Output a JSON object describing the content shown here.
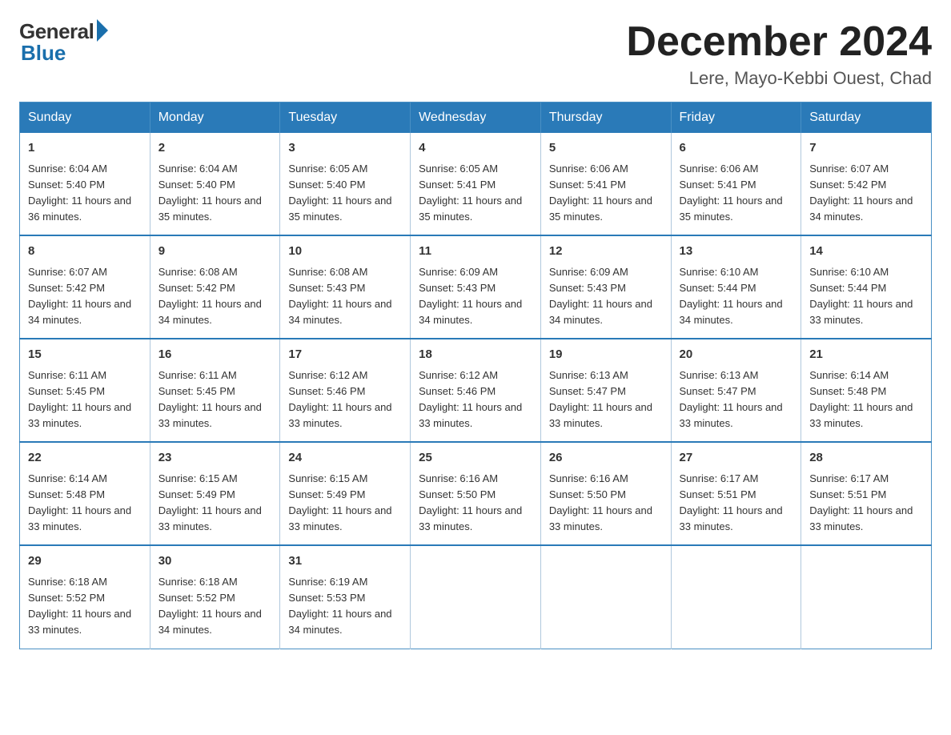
{
  "header": {
    "logo_general": "General",
    "logo_blue": "Blue",
    "month_title": "December 2024",
    "location": "Lere, Mayo-Kebbi Ouest, Chad"
  },
  "days_of_week": [
    "Sunday",
    "Monday",
    "Tuesday",
    "Wednesday",
    "Thursday",
    "Friday",
    "Saturday"
  ],
  "weeks": [
    [
      {
        "day": "1",
        "sunrise": "6:04 AM",
        "sunset": "5:40 PM",
        "daylight": "11 hours and 36 minutes."
      },
      {
        "day": "2",
        "sunrise": "6:04 AM",
        "sunset": "5:40 PM",
        "daylight": "11 hours and 35 minutes."
      },
      {
        "day": "3",
        "sunrise": "6:05 AM",
        "sunset": "5:40 PM",
        "daylight": "11 hours and 35 minutes."
      },
      {
        "day": "4",
        "sunrise": "6:05 AM",
        "sunset": "5:41 PM",
        "daylight": "11 hours and 35 minutes."
      },
      {
        "day": "5",
        "sunrise": "6:06 AM",
        "sunset": "5:41 PM",
        "daylight": "11 hours and 35 minutes."
      },
      {
        "day": "6",
        "sunrise": "6:06 AM",
        "sunset": "5:41 PM",
        "daylight": "11 hours and 35 minutes."
      },
      {
        "day": "7",
        "sunrise": "6:07 AM",
        "sunset": "5:42 PM",
        "daylight": "11 hours and 34 minutes."
      }
    ],
    [
      {
        "day": "8",
        "sunrise": "6:07 AM",
        "sunset": "5:42 PM",
        "daylight": "11 hours and 34 minutes."
      },
      {
        "day": "9",
        "sunrise": "6:08 AM",
        "sunset": "5:42 PM",
        "daylight": "11 hours and 34 minutes."
      },
      {
        "day": "10",
        "sunrise": "6:08 AM",
        "sunset": "5:43 PM",
        "daylight": "11 hours and 34 minutes."
      },
      {
        "day": "11",
        "sunrise": "6:09 AM",
        "sunset": "5:43 PM",
        "daylight": "11 hours and 34 minutes."
      },
      {
        "day": "12",
        "sunrise": "6:09 AM",
        "sunset": "5:43 PM",
        "daylight": "11 hours and 34 minutes."
      },
      {
        "day": "13",
        "sunrise": "6:10 AM",
        "sunset": "5:44 PM",
        "daylight": "11 hours and 34 minutes."
      },
      {
        "day": "14",
        "sunrise": "6:10 AM",
        "sunset": "5:44 PM",
        "daylight": "11 hours and 33 minutes."
      }
    ],
    [
      {
        "day": "15",
        "sunrise": "6:11 AM",
        "sunset": "5:45 PM",
        "daylight": "11 hours and 33 minutes."
      },
      {
        "day": "16",
        "sunrise": "6:11 AM",
        "sunset": "5:45 PM",
        "daylight": "11 hours and 33 minutes."
      },
      {
        "day": "17",
        "sunrise": "6:12 AM",
        "sunset": "5:46 PM",
        "daylight": "11 hours and 33 minutes."
      },
      {
        "day": "18",
        "sunrise": "6:12 AM",
        "sunset": "5:46 PM",
        "daylight": "11 hours and 33 minutes."
      },
      {
        "day": "19",
        "sunrise": "6:13 AM",
        "sunset": "5:47 PM",
        "daylight": "11 hours and 33 minutes."
      },
      {
        "day": "20",
        "sunrise": "6:13 AM",
        "sunset": "5:47 PM",
        "daylight": "11 hours and 33 minutes."
      },
      {
        "day": "21",
        "sunrise": "6:14 AM",
        "sunset": "5:48 PM",
        "daylight": "11 hours and 33 minutes."
      }
    ],
    [
      {
        "day": "22",
        "sunrise": "6:14 AM",
        "sunset": "5:48 PM",
        "daylight": "11 hours and 33 minutes."
      },
      {
        "day": "23",
        "sunrise": "6:15 AM",
        "sunset": "5:49 PM",
        "daylight": "11 hours and 33 minutes."
      },
      {
        "day": "24",
        "sunrise": "6:15 AM",
        "sunset": "5:49 PM",
        "daylight": "11 hours and 33 minutes."
      },
      {
        "day": "25",
        "sunrise": "6:16 AM",
        "sunset": "5:50 PM",
        "daylight": "11 hours and 33 minutes."
      },
      {
        "day": "26",
        "sunrise": "6:16 AM",
        "sunset": "5:50 PM",
        "daylight": "11 hours and 33 minutes."
      },
      {
        "day": "27",
        "sunrise": "6:17 AM",
        "sunset": "5:51 PM",
        "daylight": "11 hours and 33 minutes."
      },
      {
        "day": "28",
        "sunrise": "6:17 AM",
        "sunset": "5:51 PM",
        "daylight": "11 hours and 33 minutes."
      }
    ],
    [
      {
        "day": "29",
        "sunrise": "6:18 AM",
        "sunset": "5:52 PM",
        "daylight": "11 hours and 33 minutes."
      },
      {
        "day": "30",
        "sunrise": "6:18 AM",
        "sunset": "5:52 PM",
        "daylight": "11 hours and 34 minutes."
      },
      {
        "day": "31",
        "sunrise": "6:19 AM",
        "sunset": "5:53 PM",
        "daylight": "11 hours and 34 minutes."
      },
      null,
      null,
      null,
      null
    ]
  ]
}
